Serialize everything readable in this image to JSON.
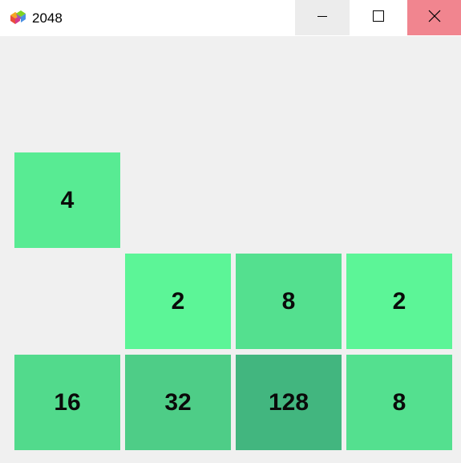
{
  "window": {
    "title": "2048",
    "app_icon": "colorful-cubes-icon",
    "controls": {
      "minimize_icon": "minimize-icon",
      "maximize_icon": "maximize-icon",
      "close_icon": "close-icon"
    }
  },
  "board": {
    "rows": 4,
    "cols": 4,
    "tiles": [
      {
        "row": 1,
        "col": 0,
        "value": "4",
        "color": "#58eb93"
      },
      {
        "row": 2,
        "col": 1,
        "value": "2",
        "color": "#5cf597"
      },
      {
        "row": 2,
        "col": 2,
        "value": "8",
        "color": "#54e08f"
      },
      {
        "row": 2,
        "col": 3,
        "value": "2",
        "color": "#5cf597"
      },
      {
        "row": 3,
        "col": 0,
        "value": "16",
        "color": "#52da8c"
      },
      {
        "row": 3,
        "col": 1,
        "value": "32",
        "color": "#4ecd87"
      },
      {
        "row": 3,
        "col": 2,
        "value": "128",
        "color": "#42b67f"
      },
      {
        "row": 3,
        "col": 3,
        "value": "8",
        "color": "#54e08f"
      }
    ]
  }
}
